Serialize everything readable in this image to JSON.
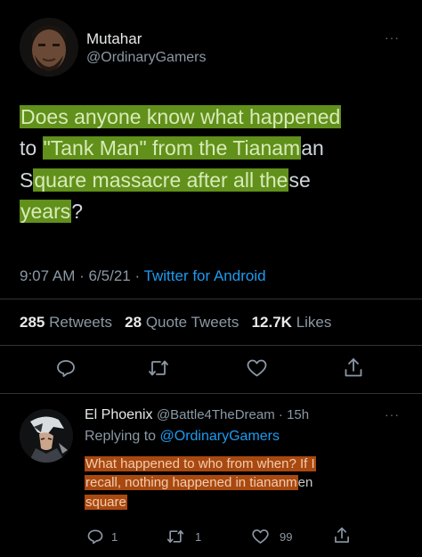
{
  "tweet": {
    "author_name": "Mutahar",
    "author_handle": "@OrdinaryGamers",
    "text_parts": [
      "Does anyone know what happened",
      "to ",
      "\"Tank Man\" from the Tianam",
      "an",
      "S",
      "quare massacre after all the",
      "se",
      "years",
      "?"
    ],
    "time": "9:07 AM · 6/5/21 · ",
    "source": "Twitter for Android",
    "retweets_count": "285",
    "retweets_label": "Retweets",
    "quotes_count": "28",
    "quotes_label": "Quote Tweets",
    "likes_count": "12.7K",
    "likes_label": "Likes"
  },
  "reply": {
    "author_name": "El Phoenix",
    "author_handle": "@Battle4TheDream · 15h",
    "replying_label": "Replying to ",
    "replying_handle": "@OrdinaryGamers",
    "text_parts": [
      "What happened to who from when? If I",
      "recall, nothing happened in tiananm",
      "en",
      "square"
    ],
    "reply_count": "1",
    "retweet_count": "1",
    "like_count": "99"
  },
  "icons": {
    "more": "more-icon",
    "reply": "reply-icon",
    "retweet": "retweet-icon",
    "like": "heart-icon",
    "share": "share-icon"
  },
  "colors": {
    "highlight_green": "#86c826",
    "highlight_orange": "#ce5914",
    "link": "#1d9bf0",
    "background": "#000000"
  },
  "more_glyph": "···"
}
